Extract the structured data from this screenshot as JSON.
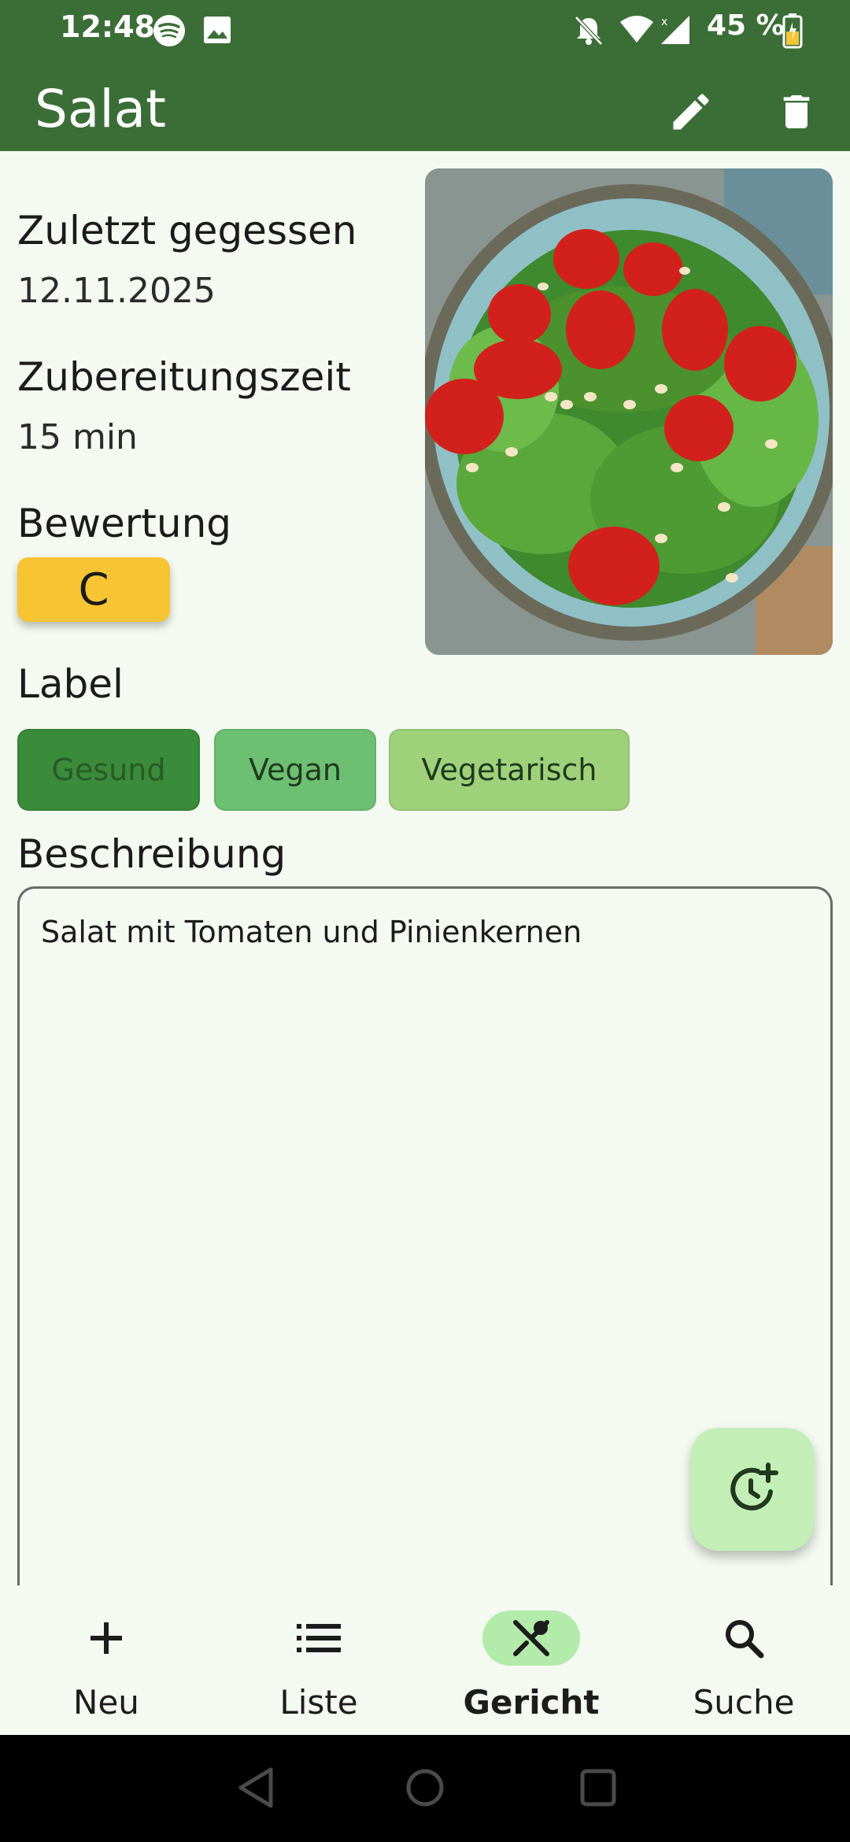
{
  "status_bar": {
    "time": "12:48",
    "battery": "45 %",
    "icons": [
      "spotify-icon",
      "image-icon",
      "bell-off-icon",
      "wifi-icon",
      "signal-icon",
      "battery-icon"
    ]
  },
  "app_bar": {
    "title": "Salat",
    "actions": [
      "edit-icon",
      "delete-icon"
    ]
  },
  "details": {
    "last_eaten_label": "Zuletzt gegessen",
    "last_eaten_value": "12.11.2025",
    "prep_time_label": "Zubereitungszeit",
    "prep_time_value": "15 min",
    "rating_label": "Bewertung",
    "rating_value": "C",
    "labels_heading": "Label",
    "tags": [
      {
        "label": "Gesund",
        "color": "#3a8b3a"
      },
      {
        "label": "Vegan",
        "color": "#6dbf72"
      },
      {
        "label": "Vegetarisch",
        "color": "#9fd17a"
      }
    ],
    "description_heading": "Beschreibung",
    "description": "Salat mit Tomaten und Pinienkernen"
  },
  "fab": {
    "icon": "history-add-icon"
  },
  "bottom_nav": {
    "items": [
      {
        "label": "Neu",
        "icon": "plus-icon"
      },
      {
        "label": "Liste",
        "icon": "list-icon"
      },
      {
        "label": "Gericht",
        "icon": "utensils-icon",
        "active": true
      },
      {
        "label": "Suche",
        "icon": "search-icon"
      }
    ]
  },
  "colors": {
    "app_bar": "#3b6e37",
    "background": "#f4f9f1",
    "rating": "#f7c533",
    "fab": "#c3efb7",
    "nav_active": "#b3ebaa"
  }
}
